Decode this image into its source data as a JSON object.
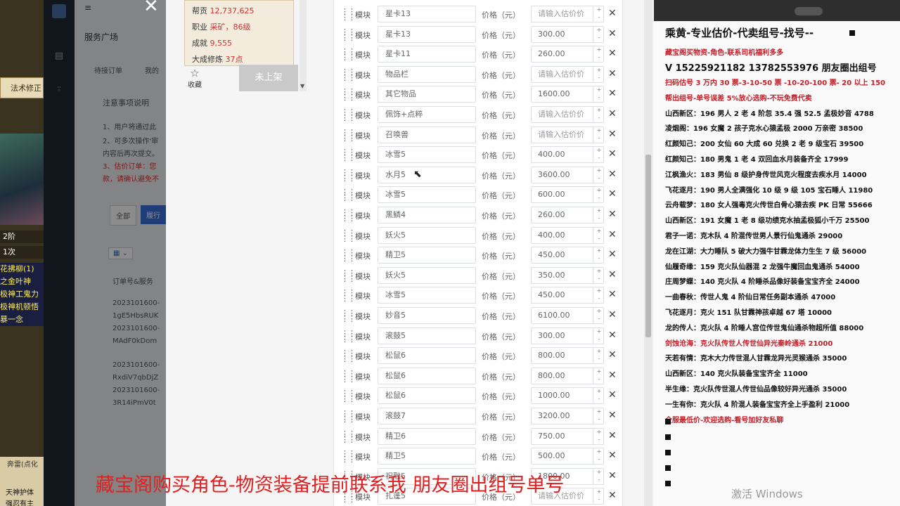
{
  "game_left": {
    "tab": "法术修正",
    "lines": [
      "2阶",
      "1次",
      "花拂柳(1)",
      "之金叶神",
      "极神工鬼力",
      "极神机顿悟",
      "暴一念"
    ],
    "bottom_tab": "奔雷(点化",
    "bottom_lines": [
      "天神护体",
      "强忍有主"
    ]
  },
  "behind_page": {
    "title": "服务广场",
    "tabs": [
      "待接订单",
      "我的"
    ],
    "notice_title": "注意事项说明",
    "notice_lines": [
      "1、用户将通过此",
      "2、可多次操作'审",
      "内容后再次提交。",
      "3、估价订单：您",
      "款，请确认避免不"
    ],
    "filter_all": "全部",
    "filter_active": "履行",
    "order_header": "订单号&服务",
    "orders": [
      "2023101600-",
      "1gE5HbsRUK",
      "2023101600-",
      "MAdF0kDom",
      "2023101600-",
      "RxdiV7qbDjZ",
      "2023101600-",
      "3R14iPmV0t"
    ]
  },
  "info_box": {
    "gang_label": "帮贡",
    "gang_value": "12,737,625",
    "job_label": "职业",
    "job_value": "采矿，86级",
    "achieve_label": "成就",
    "achieve_value": "9,555",
    "grand_label": "大成修炼",
    "grand_value": "37点"
  },
  "favorite_label": "收藏",
  "off_shelf_button": "未上架",
  "module_label": "模块",
  "price_label": "价格（元）",
  "price_placeholder": "请输入估价价",
  "rows": [
    {
      "name": "星卡13",
      "price": ""
    },
    {
      "name": "星卡13",
      "price": "300.00"
    },
    {
      "name": "星卡11",
      "price": "260.00"
    },
    {
      "name": "物品栏",
      "price": ""
    },
    {
      "name": "其它物品",
      "price": "1600.00"
    },
    {
      "name": "佩饰+点粹",
      "price": ""
    },
    {
      "name": "召唤兽",
      "price": ""
    },
    {
      "name": "冰雪5",
      "price": "400.00"
    },
    {
      "name": "水月5",
      "price": "3600.00"
    },
    {
      "name": "冰雪5",
      "price": "600.00"
    },
    {
      "name": "黑鳞4",
      "price": "260.00"
    },
    {
      "name": "妖火5",
      "price": "400.00"
    },
    {
      "name": "精卫5",
      "price": "450.00"
    },
    {
      "name": "妖火5",
      "price": "350.00"
    },
    {
      "name": "冰雪5",
      "price": "450.00"
    },
    {
      "name": "妙音5",
      "price": "6100.00"
    },
    {
      "name": "滚鼓5",
      "price": "300.00"
    },
    {
      "name": "松鼠6",
      "price": "800.00"
    },
    {
      "name": "松鼠6",
      "price": "800.00"
    },
    {
      "name": "松鼠6",
      "price": "1000.00"
    },
    {
      "name": "滚鼓7",
      "price": "3200.00"
    },
    {
      "name": "精卫6",
      "price": "750.00"
    },
    {
      "name": "精卫5",
      "price": "500.00"
    },
    {
      "name": "祝融5",
      "price": "1800.00"
    },
    {
      "name": "扎蓬5",
      "price": ""
    }
  ],
  "notes": {
    "title": "乘黄-专业估价-代卖组号-找号--",
    "lines": [
      {
        "text": "藏宝阁买物资-角色-联系司机福利多多",
        "red": true
      },
      {
        "text": "V 15225921182   13782553976 朋友圈出组号",
        "red": false,
        "big": true
      },
      {
        "text": "扫码估号 3 万内 30 票-3-10-50 票  -10-20-100 票- 20 以上 150",
        "red": true
      },
      {
        "text": "帮出组号-单号误差 5%放心选购-不玩免费代卖",
        "red": true
      },
      {
        "text": "山西新区：196 男人 2 老 4 阶忽 35.4 强 52.5 孟极妙音 4788",
        "red": false
      },
      {
        "text": "凌烟阁：196 女魔 2 孩子克水心猿孟极 2000 万亲密 38500",
        "red": false
      },
      {
        "text": "红颜知己：200 女仙 60 大成 60 兑换 2 老 9 级宝石 39500",
        "red": false
      },
      {
        "text": "红颜知己：180 男鬼 1 老 4 双回血水月装备齐全 17999",
        "red": false
      },
      {
        "text": "江枫渔火：183 男仙 8 级护身传世风克火程度去疾水月 14000",
        "red": false
      },
      {
        "text": "飞花逐月：190 男人全满强化 10 级 9 级 105 宝石睡人 11980",
        "red": false
      },
      {
        "text": "云舟载梦：180 女人强毒克火传世白骨心猿去疾 PK 日常 55666",
        "red": false
      },
      {
        "text": "山西新区：191 女魔 1 老 8 级功绩克水抽孟极狐小千万 25500",
        "red": false
      },
      {
        "text": "君子一诺：克木队 4 阶混传世男人景行仙鬼通杀 29000",
        "red": false
      },
      {
        "text": "龙在江湖：大力睡队 5 破大力强牛甘霖龙体力生生 7 级 56000",
        "red": false
      },
      {
        "text": "仙履奇缘：159 克火队仙器混 2 龙强牛魔回血鬼通杀 54000",
        "red": false
      },
      {
        "text": "庄周梦蝶：140 克火队 4 阶睡杀品像好装备宝宝齐全 24000",
        "red": false
      },
      {
        "text": "一曲春秋：传世人鬼 4 阶仙日常任务副本通杀 47000",
        "red": false
      },
      {
        "text": "飞花逐月：克火 151 队甘霖神孩卓越 67 塔 10000",
        "red": false
      },
      {
        "text": "龙的传人：克火队 4 阶睡人宫位传世鬼仙通杀物超所值 88000",
        "red": false
      },
      {
        "text": "剑蚀沧海：克火队传世人传世仙异光秦岭通杀 21000",
        "red": true
      },
      {
        "text": "天若有情：克木大力传世混人甘霖龙异光灵猴通杀 35000",
        "red": false
      },
      {
        "text": "山西新区：140 克火队装备宝宝齐全 11000",
        "red": false
      },
      {
        "text": "半生缘：克火队传世混人传世仙品像较好异光通杀 35000",
        "red": false
      },
      {
        "text": "一生有你：克火队 4 阶混人装备宝宝齐全上手盈利 21000",
        "red": false
      },
      {
        "text": "全服最低价-欢迎选购-看号加好友私聊",
        "red": true
      }
    ]
  },
  "caption": "藏宝阁购买角色-物资装备提前联系我     朋友圈出组号单号",
  "watermark": "激活 Windows"
}
